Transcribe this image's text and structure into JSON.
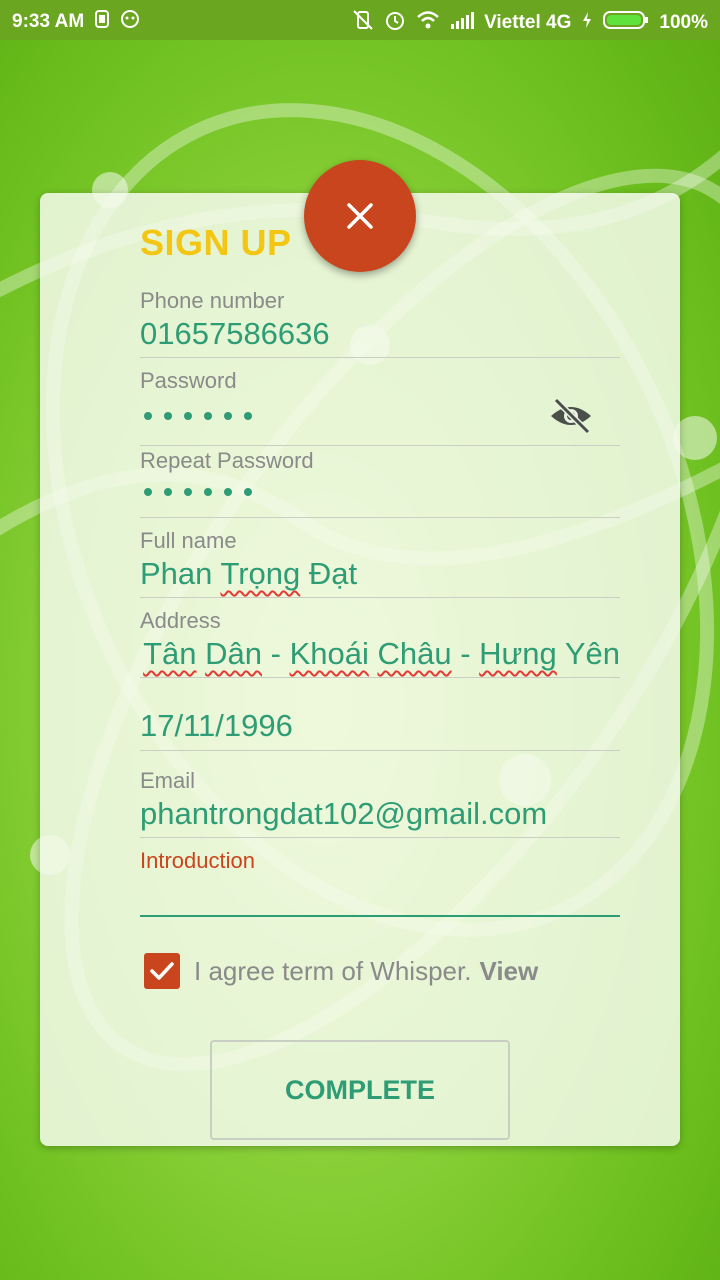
{
  "status_bar": {
    "time": "9:33 AM",
    "carrier": "Viettel 4G",
    "battery": "100%",
    "battery_level": 1.0,
    "icons": [
      "sim-icon",
      "android-icon",
      "vibrate-off-icon",
      "alarm-icon",
      "wifi-icon",
      "signal-icon",
      "charging-icon",
      "battery-icon"
    ]
  },
  "form": {
    "title": "SIGN UP",
    "close_icon": "close-icon",
    "phone": {
      "label": "Phone number",
      "value": "01657586636"
    },
    "password": {
      "label": "Password",
      "masked_length": 6,
      "toggle_icon": "eye-off-icon"
    },
    "repeat_password": {
      "label": "Repeat Password",
      "masked_length": 6
    },
    "full_name": {
      "label": "Full name",
      "value_parts": [
        "Phan ",
        "Trọng",
        " Đạt"
      ]
    },
    "address": {
      "label": "Address",
      "value_parts": [
        "Tân",
        " ",
        "Dân",
        " - ",
        "Khoái",
        " ",
        "Châu",
        " - ",
        "Hưng",
        " Yên"
      ]
    },
    "birthday": {
      "value": "17/11/1996"
    },
    "email": {
      "label": "Email",
      "value": "phantrongdat102@gmail.com"
    },
    "introduction": {
      "label": "Introduction",
      "value": ""
    },
    "agree": {
      "text": "I agree term of Whisper.",
      "link": "View",
      "checked": true
    },
    "complete_button": "COMPLETE"
  },
  "colors": {
    "accent": "#2e9c74",
    "title": "#f3c614",
    "danger": "#c9451e",
    "statusbar": "#6aa61f"
  }
}
